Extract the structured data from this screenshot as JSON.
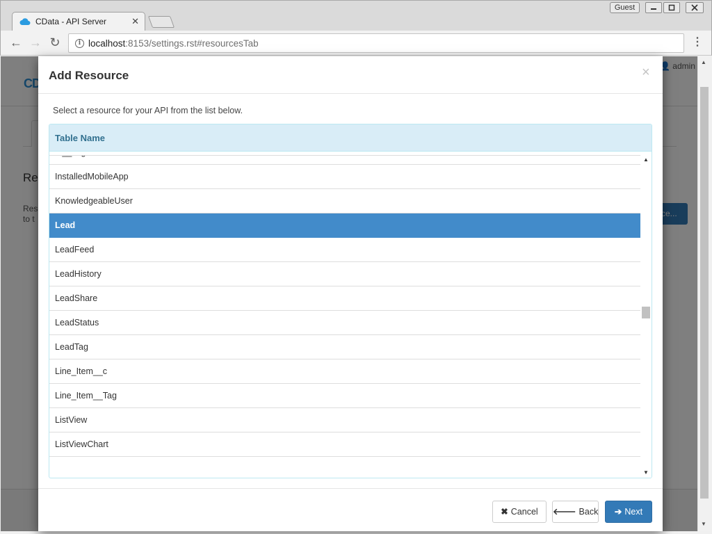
{
  "browser": {
    "tab_title": "CData - API Server",
    "tab_close": "✕",
    "profile_label": "Guest",
    "window_controls": {
      "minimize": "▭",
      "restore": "□",
      "close": "✕"
    },
    "url_host": "localhost",
    "url_path": ":8153/settings.rst#resourcesTab",
    "favicon": "cloud-icon",
    "back_icon": "←",
    "forward_icon": "→",
    "reload_icon": "↻",
    "menu_icon": "⋮"
  },
  "background_page": {
    "logo_prefix": "C",
    "logo_accent": "D",
    "user_menu": "👤 admin ▾",
    "heading_fragment": "Res",
    "desc_fragment_1": "Reso",
    "desc_fragment_2": "to t",
    "add_button_fragment": "ce..."
  },
  "modal": {
    "title": "Add Resource",
    "close_label": "×",
    "intro": "Select a resource for your API from the list below.",
    "table": {
      "column_header": "Table Name",
      "rows": [
        {
          "name": "Id__Tag",
          "selected": false
        },
        {
          "name": "InstalledMobileApp",
          "selected": false
        },
        {
          "name": "KnowledgeableUser",
          "selected": false
        },
        {
          "name": "Lead",
          "selected": true
        },
        {
          "name": "LeadFeed",
          "selected": false
        },
        {
          "name": "LeadHistory",
          "selected": false
        },
        {
          "name": "LeadShare",
          "selected": false
        },
        {
          "name": "LeadStatus",
          "selected": false
        },
        {
          "name": "LeadTag",
          "selected": false
        },
        {
          "name": "Line_Item__c",
          "selected": false
        },
        {
          "name": "Line_Item__Tag",
          "selected": false
        },
        {
          "name": "ListView",
          "selected": false
        },
        {
          "name": "ListViewChart",
          "selected": false
        }
      ]
    },
    "buttons": {
      "cancel": {
        "icon": "✖",
        "label": "Cancel"
      },
      "back": {
        "icon": "🡐",
        "label": "Back"
      },
      "next": {
        "icon": "➔",
        "label": "Next"
      }
    }
  },
  "colors": {
    "selected_row": "#428bca",
    "header_bg": "#d9edf7",
    "header_text": "#31708f",
    "primary_button": "#337ab7"
  }
}
